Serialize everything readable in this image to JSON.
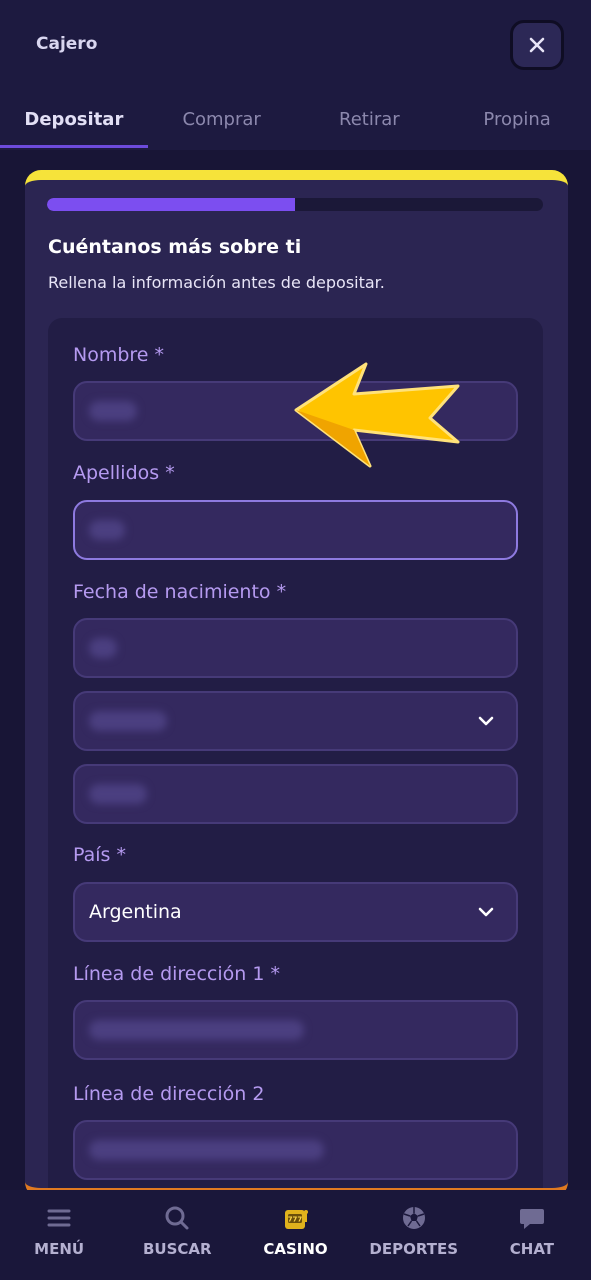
{
  "header": {
    "title": "Cajero",
    "close_icon": "close-icon"
  },
  "tabs": [
    {
      "label": "Depositar",
      "active": true
    },
    {
      "label": "Comprar",
      "active": false
    },
    {
      "label": "Retirar",
      "active": false
    },
    {
      "label": "Propina",
      "active": false
    }
  ],
  "form": {
    "progress_fraction": 0.5,
    "title": "Cuéntanos más sobre ti",
    "subtitle": "Rellena la información antes de depositar.",
    "first_name_label": "Nombre *",
    "last_name_label": "Apellidos *",
    "birthdate_label": "Fecha de nacimiento *",
    "country_label": "País *",
    "country_value": "Argentina",
    "address1_label": "Línea de dirección 1 *",
    "address2_label": "Línea de dirección 2"
  },
  "nav": {
    "menu": "MENÚ",
    "search": "BUSCAR",
    "casino": "CASINO",
    "sports": "DEPORTES",
    "chat": "CHAT"
  },
  "colors": {
    "background": "#181536",
    "accent": "#7c4ef0",
    "label": "#b59af0",
    "card_top": "#f6e33a",
    "card_bottom": "#e07a21",
    "arrow": "#ffc400"
  }
}
